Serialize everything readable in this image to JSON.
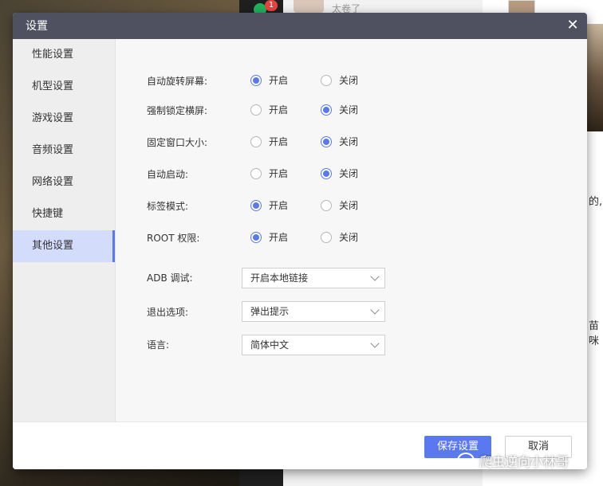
{
  "background": {
    "badge_count": "1",
    "chat_preview": "太卷了",
    "snippet_1": "的,",
    "snippet_2": "苗咪"
  },
  "watermark": "爬虫逆向小林哥",
  "dialog": {
    "title": "设置",
    "sidebar": [
      {
        "label": "性能设置",
        "active": false
      },
      {
        "label": "机型设置",
        "active": false
      },
      {
        "label": "游戏设置",
        "active": false
      },
      {
        "label": "音频设置",
        "active": false
      },
      {
        "label": "网络设置",
        "active": false
      },
      {
        "label": "快捷键",
        "active": false
      },
      {
        "label": "其他设置",
        "active": true
      }
    ],
    "radio_on_label": "开启",
    "radio_off_label": "关闭",
    "settings": [
      {
        "label": "自动旋转屏幕:",
        "value": "开启"
      },
      {
        "label": "强制锁定横屏:",
        "value": "关闭"
      },
      {
        "label": "固定窗口大小:",
        "value": "关闭"
      },
      {
        "label": "自动启动:",
        "value": "关闭"
      },
      {
        "label": "标签模式:",
        "value": "开启"
      },
      {
        "label": "ROOT 权限:",
        "value": "开启"
      }
    ],
    "selects": [
      {
        "label": "ADB 调试:",
        "value": "开启本地链接"
      },
      {
        "label": "退出选项:",
        "value": "弹出提示"
      },
      {
        "label": "语言:",
        "value": "简体中文"
      }
    ],
    "save_label": "保存设置",
    "cancel_label": "取消",
    "accent_color": "#5a79f0"
  }
}
